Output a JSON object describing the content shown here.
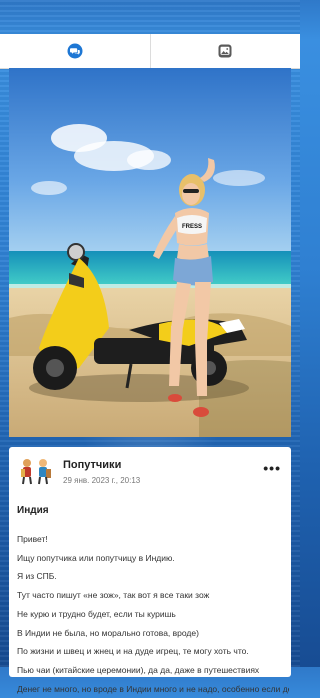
{
  "tabs": [
    {
      "name": "chat",
      "icon": "chat-bubble-icon"
    },
    {
      "name": "photos",
      "icon": "image-icon"
    }
  ],
  "colors": {
    "accent": "#1e77d4",
    "background": "#2f80d2"
  },
  "post": {
    "author": "Попутчики",
    "date": "29 янв. 2023 г., 20:13",
    "title": "Индия",
    "lines": [
      "Привет!",
      "Ищу попутчика или попутчицу в Индию.",
      "Я из СПБ.",
      "Тут часто пишут «не зож», так вот я все таки зож",
      "Не курю и трудно будет, если ты куришь",
      "В Индии не была, но морально готова, вроде)",
      "По жизни и швец и жнец и на дуде игрец, те могу хоть что.",
      "Пью чаи (китайские церемонии), да да, даже в путешествиях",
      "Денег не много, но вроде в Индии много и не надо, особенно если делишь"
    ]
  },
  "photo": {
    "shirt_text": "FRESS"
  }
}
